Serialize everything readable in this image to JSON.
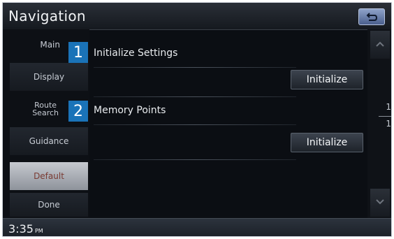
{
  "header": {
    "title": "Navigation"
  },
  "sidebar": {
    "items": [
      {
        "label": "Main"
      },
      {
        "label": "Display"
      },
      {
        "label": "Route\nSearch"
      },
      {
        "label": "Guidance"
      },
      {
        "label": "Default"
      },
      {
        "label": "Done"
      }
    ]
  },
  "settings": [
    {
      "badge": "1",
      "label": "Initialize Settings",
      "button": "Initialize"
    },
    {
      "badge": "2",
      "label": "Memory Points",
      "button": "Initialize"
    }
  ],
  "scroll": {
    "current_page": "1",
    "total_pages": "1"
  },
  "status": {
    "time": "3:35",
    "ampm": "PM"
  },
  "colors": {
    "selected_item_bg": "#b7bbc2",
    "badge": "#1a73b8",
    "back_button": "#6f84b0"
  }
}
